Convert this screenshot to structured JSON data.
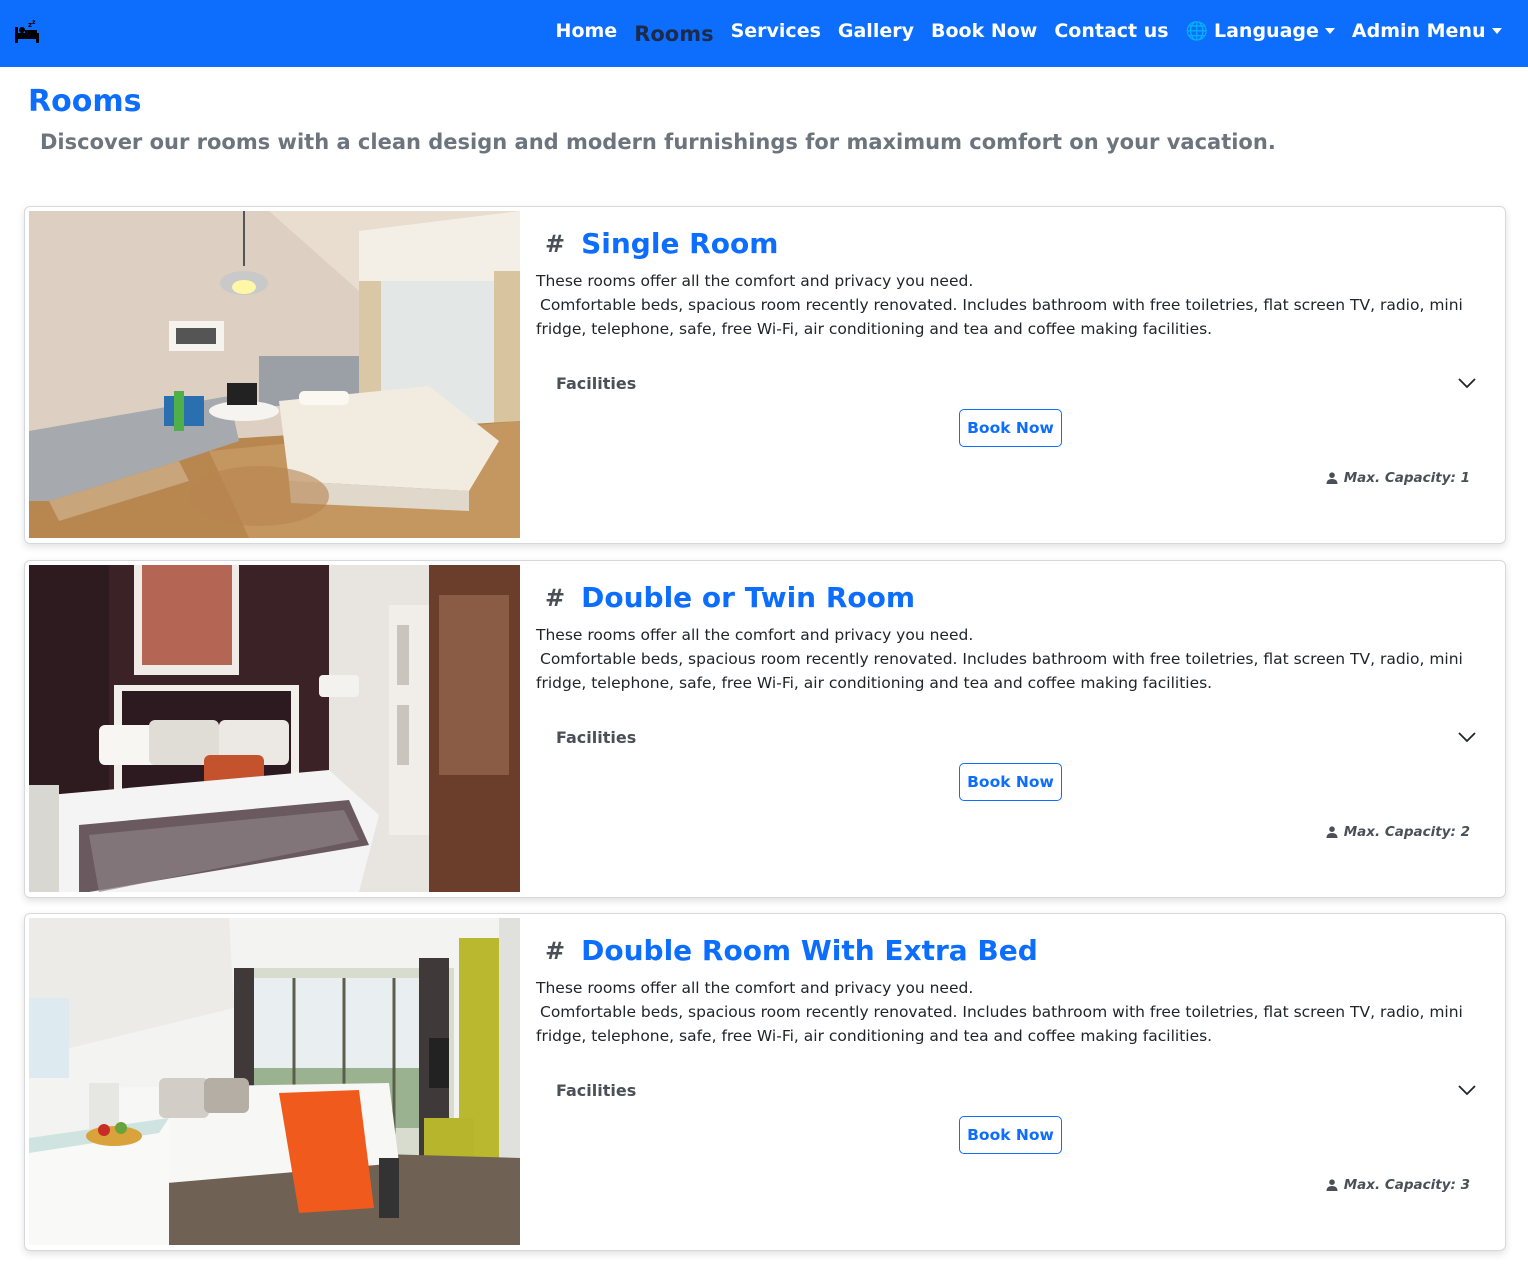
{
  "navbar": {
    "brand_icon": "bed-sleeping-icon",
    "links": [
      {
        "label": "Home"
      },
      {
        "label": "Rooms",
        "active": true
      },
      {
        "label": "Services"
      },
      {
        "label": "Gallery"
      },
      {
        "label": "Book Now"
      },
      {
        "label": "Contact us"
      }
    ],
    "language": {
      "icon": "globe-icon",
      "label": "Language"
    },
    "admin": {
      "label": "Admin Menu"
    },
    "colors": {
      "background": "#0d6efd",
      "active_link": "#1c2b4a"
    }
  },
  "page": {
    "title": "Rooms",
    "subtitle": "Discover our rooms with a clean design and modern furnishings for maximum comfort on your vacation."
  },
  "rooms": [
    {
      "title": "Single Room",
      "desc_line1": "These rooms offer all the comfort and privacy you need.",
      "desc_line2": "Comfortable beds, spacious room recently renovated. Includes bathroom with free toiletries, flat screen TV, radio, mini fridge, telephone, safe, free Wi-Fi, air conditioning and tea and coffee making facilities.",
      "facilities_label": "Facilities",
      "book_label": "Book Now",
      "capacity": "Max. Capacity: 1",
      "image": "single-room-photo"
    },
    {
      "title": "Double or Twin Room",
      "desc_line1": "These rooms offer all the comfort and privacy you need.",
      "desc_line2": "Comfortable beds, spacious room recently renovated. Includes bathroom with free toiletries, flat screen TV, radio, mini fridge, telephone, safe, free Wi-Fi, air conditioning and tea and coffee making facilities.",
      "facilities_label": "Facilities",
      "book_label": "Book Now",
      "capacity": "Max. Capacity: 2",
      "image": "double-room-photo"
    },
    {
      "title": "Double Room With Extra Bed",
      "desc_line1": "These rooms offer all the comfort and privacy you need.",
      "desc_line2": "Comfortable beds, spacious room recently renovated. Includes bathroom with free toiletries, flat screen TV, radio, mini fridge, telephone, safe, free Wi-Fi, air conditioning and tea and coffee making facilities.",
      "facilities_label": "Facilities",
      "book_label": "Book Now",
      "capacity": "Max. Capacity: 3",
      "image": "extra-bed-room-photo"
    }
  ],
  "colors": {
    "accent": "#0d6efd",
    "muted": "#6c757d"
  }
}
